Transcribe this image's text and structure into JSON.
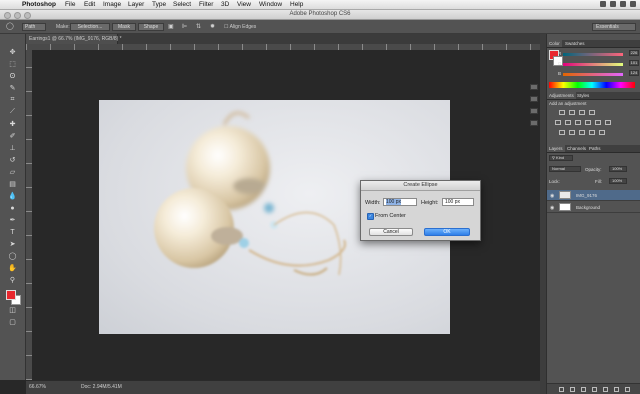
{
  "menubar": {
    "app_name": "Photoshop",
    "items": [
      "File",
      "Edit",
      "Image",
      "Layer",
      "Type",
      "Select",
      "Filter",
      "3D",
      "View",
      "Window",
      "Help"
    ]
  },
  "window": {
    "title": "Adobe Photoshop CS6"
  },
  "options_bar": {
    "mode": "Path",
    "make_label": "Make:",
    "selection_label": "Selection...",
    "mask_label": "Mask",
    "shape_label": "Shape",
    "align_edges_label": "Align Edges",
    "workspace": "Essentials"
  },
  "document": {
    "tab_label": "Earrings1 @ 66.7% (IMG_9176, RGB/8) *"
  },
  "status": {
    "zoom": "66.67%",
    "doc_size": "Doc: 2.94M/5.41M"
  },
  "dialog": {
    "title": "Create Ellipse",
    "width_label": "Width:",
    "width_value": "100 px",
    "height_label": "Height:",
    "height_value": "100 px",
    "from_center_label": "From Center",
    "from_center_checked": true,
    "cancel_label": "Cancel",
    "ok_label": "OK"
  },
  "panels": {
    "color_tabs": [
      "Color",
      "Swatches"
    ],
    "rgb": [
      {
        "label": "R",
        "value": "226"
      },
      {
        "label": "G",
        "value": "101"
      },
      {
        "label": "B",
        "value": "124"
      }
    ],
    "adjust_tabs": [
      "Adjustments",
      "Styles"
    ],
    "adjust_heading": "Add an adjustment",
    "layers_tabs": [
      "Layers",
      "Channels",
      "Paths"
    ],
    "kind_label": "Kind",
    "blend_mode": "Normal",
    "opacity_label": "Opacity:",
    "opacity_value": "100%",
    "lock_label": "Lock:",
    "fill_label": "Fill:",
    "fill_value": "100%",
    "layers": [
      {
        "name": "IMG_9176"
      },
      {
        "name": "Background"
      }
    ]
  },
  "colors": {
    "foreground": "#e8272e",
    "background": "#ffffff",
    "ok_button": "#2f7fe8"
  }
}
